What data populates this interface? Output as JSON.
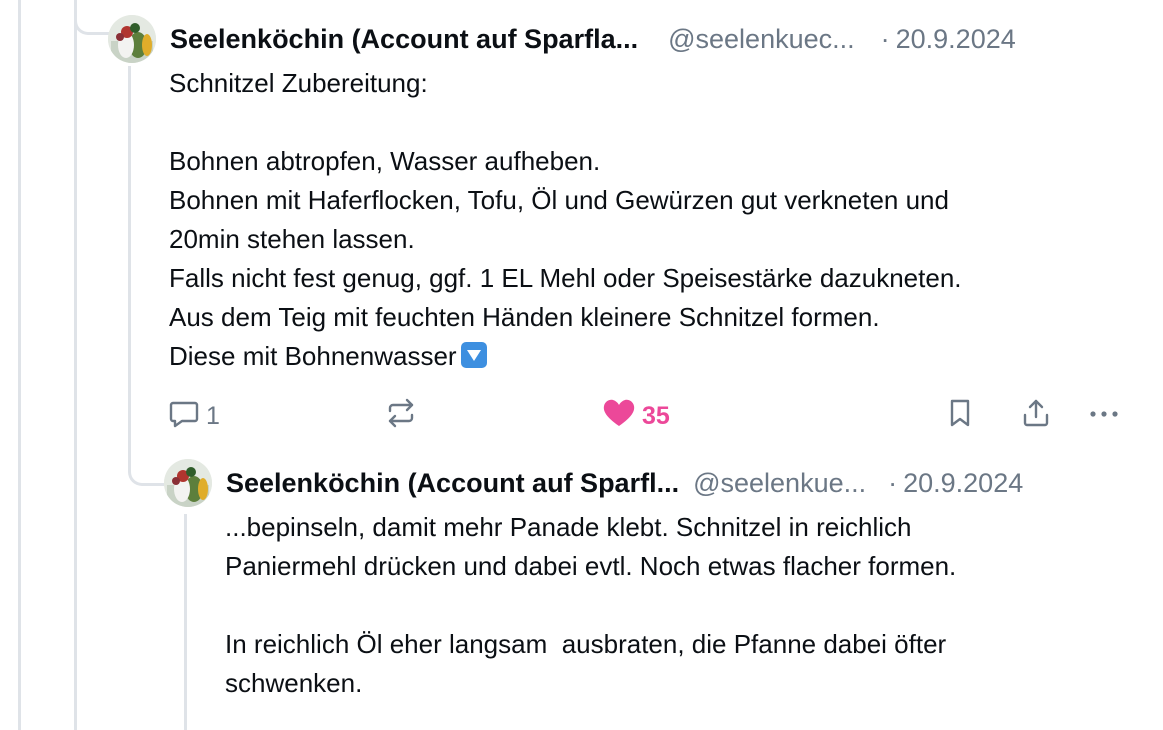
{
  "posts": [
    {
      "author": "Seelenköchin (Account auf Sparfla...",
      "handle": "@seelenkuec...",
      "separator": "·",
      "date": "20.9.2024",
      "body": "Schnitzel Zubereitung:\n\nBohnen abtropfen, Wasser aufheben.\nBohnen mit Haferflocken, Tofu, Öl und Gewürzen gut verkneten und\n20min stehen lassen.\nFalls nicht fest genug, ggf. 1 EL Mehl oder Speisestärke dazukneten.\nAus dem Teig mit feuchten Händen kleinere Schnitzel formen.\nDiese mit Bohnenwasser",
      "body_emoji": "down-arrow-emoji",
      "actions": {
        "reply_icon": "reply-icon",
        "reply_count": "1",
        "repost_icon": "repost-icon",
        "like_icon": "heart-icon",
        "like_count": "35",
        "bookmark_icon": "bookmark-icon",
        "share_icon": "share-icon",
        "more_icon": "more-icon"
      }
    },
    {
      "author": "Seelenköchin (Account auf Sparfl...",
      "handle": "@seelenkue...",
      "separator": "·",
      "date": "20.9.2024",
      "body": "...bepinseln, damit mehr Panade klebt. Schnitzel in reichlich\nPaniermehl drücken und dabei evtl. Noch etwas flacher formen.\n\nIn reichlich Öl eher langsam  ausbraten, die Pfanne dabei öfter\nschwenken."
    }
  ],
  "colors": {
    "text": "#0b0f14",
    "muted": "#6b7785",
    "like": "#ec4899",
    "thread_line": "#dfe3e8",
    "emoji_blue": "#3d8fe0"
  }
}
